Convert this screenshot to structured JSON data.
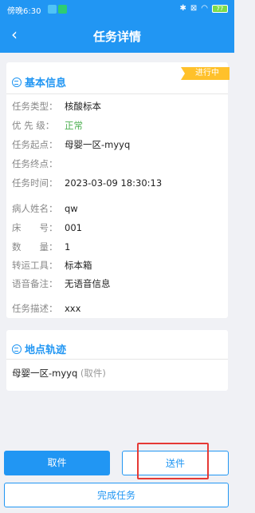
{
  "status_bar": {
    "time": "傍晚6:30",
    "battery": "77",
    "icons": [
      "bluetooth-icon",
      "no-sim-icon",
      "wifi-icon",
      "battery-icon"
    ]
  },
  "nav": {
    "title": "任务详情",
    "back_icon": "chevron-left-icon"
  },
  "basic": {
    "section_title": "基本信息",
    "status_badge": "进行中",
    "rows": [
      {
        "label": "任务类型：",
        "value": "核酸标本"
      },
      {
        "label": "优 先 级：",
        "value": "正常"
      },
      {
        "label": "任务起点：",
        "value": "母婴一区-myyq"
      },
      {
        "label": "任务终点：",
        "value": ""
      },
      {
        "label": "任务时间：",
        "value": "2023-03-09 18:30:13"
      },
      {
        "label": "病人姓名：",
        "value": "qw"
      },
      {
        "label": "床　　号：",
        "value": "001"
      },
      {
        "label": "数　　量：",
        "value": "1"
      },
      {
        "label": "转运工具：",
        "value": "标本箱"
      },
      {
        "label": "语音备注：",
        "value": "无语音信息"
      },
      {
        "label": "任务描述：",
        "value": "xxx"
      }
    ]
  },
  "route": {
    "section_title": "地点轨迹",
    "place": "母婴一区-myyq",
    "place_status": "(取件)"
  },
  "actions": {
    "cancel": "取件",
    "send": "送件",
    "complete": "完成任务"
  },
  "colors": {
    "primary": "#2196f3",
    "badge": "#ffc12b",
    "highlight": "#e53935",
    "priority": "#4caf50"
  }
}
